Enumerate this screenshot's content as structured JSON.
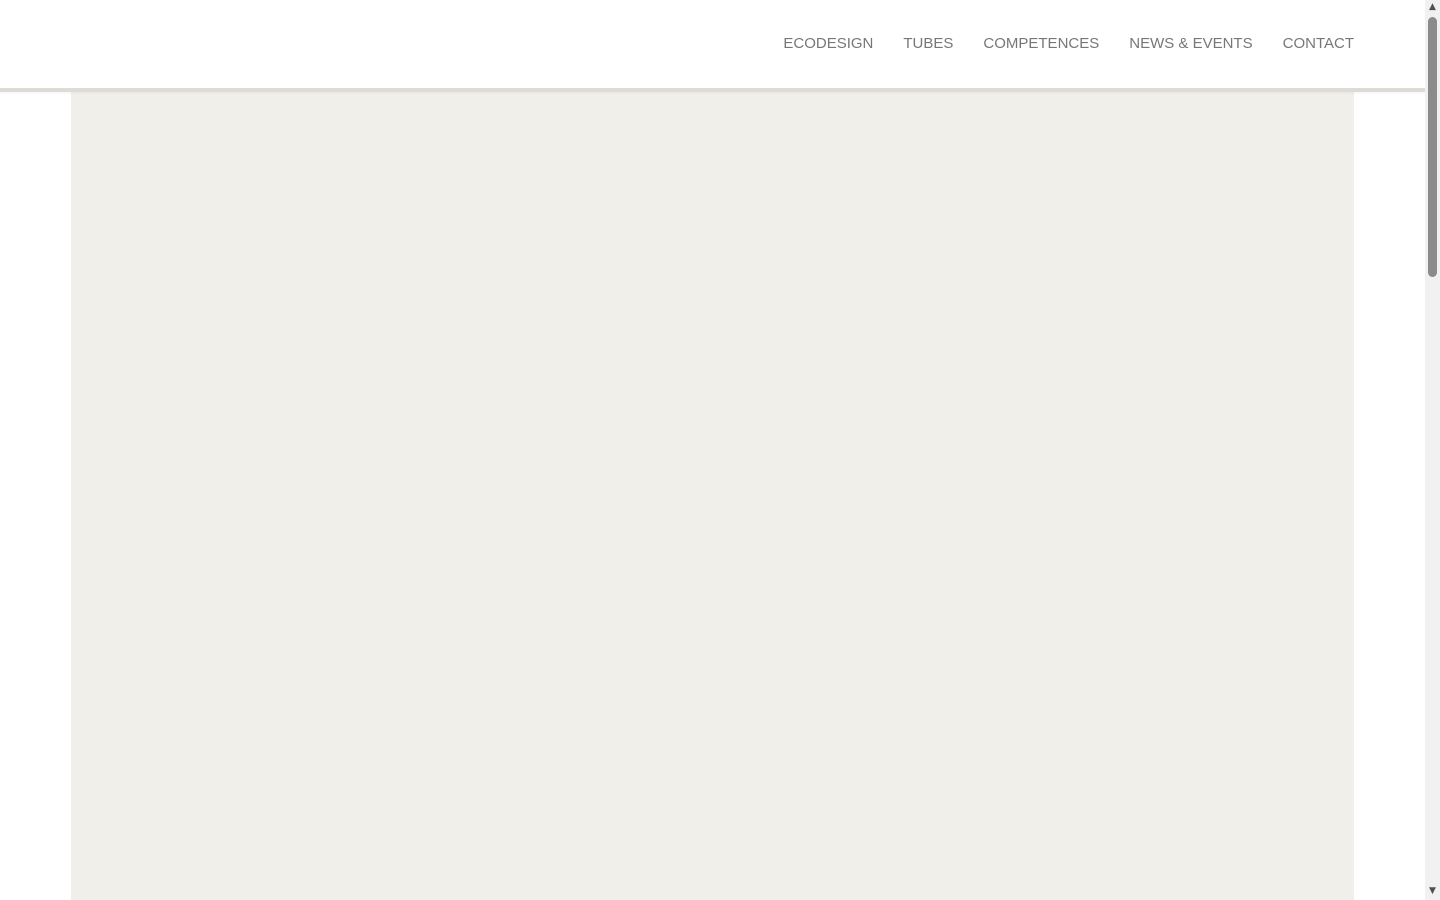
{
  "header": {
    "nav": [
      {
        "label": "ECODESIGN"
      },
      {
        "label": "TUBES"
      },
      {
        "label": "COMPETENCES"
      },
      {
        "label": "NEWS & EVENTS"
      },
      {
        "label": "CONTACT"
      }
    ]
  },
  "hero": {
    "faint_text": ""
  },
  "scrollbar": {
    "up_icon": "triangle-up-icon",
    "down_icon": "triangle-down-icon"
  },
  "colors": {
    "nav_text": "#777777",
    "hero_background": "#f1efea",
    "header_line": "#dedbd6",
    "scrollbar_track": "#f1f1f1",
    "scrollbar_thumb": "#8b8b8b"
  }
}
